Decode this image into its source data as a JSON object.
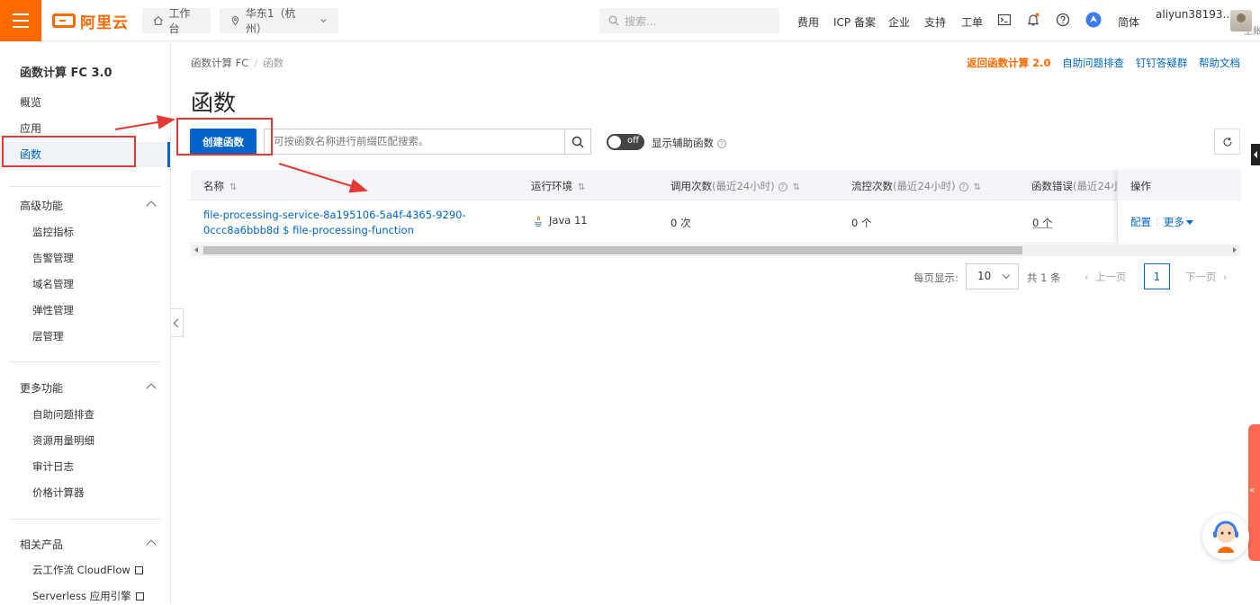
{
  "topbar": {
    "logo_text": "阿里云",
    "workbench": "工作台",
    "region": "华东1（杭州）",
    "search_placeholder": "搜索...",
    "links": [
      "费用",
      "ICP 备案",
      "企业",
      "支持",
      "工单"
    ],
    "language": "简体",
    "user_name": "aliyun38193...",
    "user_role": "主账号"
  },
  "sidebar": {
    "title": "函数计算 FC 3.0",
    "items": [
      "概览",
      "应用",
      "函数"
    ],
    "groups": [
      {
        "label": "高级功能",
        "items": [
          "监控指标",
          "告警管理",
          "域名管理",
          "弹性管理",
          "层管理"
        ]
      },
      {
        "label": "更多功能",
        "items": [
          "自助问题排查",
          "资源用量明细",
          "审计日志",
          "价格计算器"
        ]
      },
      {
        "label": "相关产品",
        "items": [
          "云工作流 CloudFlow",
          "Serverless 应用引擎"
        ]
      }
    ]
  },
  "breadcrumb": [
    "函数计算 FC",
    "函数"
  ],
  "header_links": {
    "back": "返回函数计算 2.0",
    "self_check": "自助问题排查",
    "dingtalk": "钉钉答疑群",
    "docs": "帮助文档"
  },
  "page_title": "函数",
  "toolbar": {
    "create_label": "创建函数",
    "search_placeholder": "可按函数名称进行前缀匹配搜索。",
    "toggle_text": "off",
    "aux_label": "显示辅助函数"
  },
  "table": {
    "columns": {
      "name": "名称",
      "runtime": "运行环境",
      "invocations": "调用次数",
      "invocations_sub": "(最近24小时)",
      "throttles": "流控次数",
      "throttles_sub": "(最近24小时)",
      "errors": "函数错误",
      "errors_sub": "(最近24小",
      "ops": "操作"
    },
    "rows": [
      {
        "name_line1": "file-processing-service-8a195106-5a4f-4365-9290-",
        "name_line2": "0ccc8a6bbb8d $ file-processing-function",
        "runtime": "Java 11",
        "invocations": "0 次",
        "throttles": "0 个",
        "errors": "0 个",
        "op_config": "配置",
        "op_more": "更多"
      }
    ]
  },
  "pagination": {
    "per_page_label": "每页显示:",
    "per_page": "10",
    "total": "共 1 条",
    "prev": "上一页",
    "page": "1",
    "next": "下一页"
  },
  "colors": {
    "brand_orange": "#ff6a00",
    "primary_blue": "#0064c8",
    "annotation_red": "#e53935"
  }
}
